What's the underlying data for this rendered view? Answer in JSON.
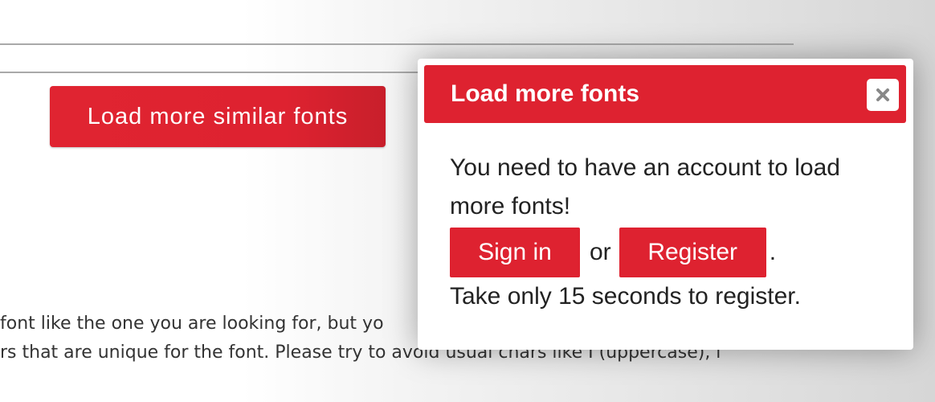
{
  "background": {
    "load_similar_label": "Load more similar fonts",
    "text_line_1": "font like the one you are looking for, but yo",
    "text_line_2": "rs that are unique for the font. Please try to avoid usual chars like I (uppercase), l"
  },
  "modal": {
    "title": "Load more fonts",
    "close_icon": "close-icon",
    "message_line_1": "You need to have an account to load",
    "message_line_2": "more fonts!",
    "signin_label": "Sign in",
    "or_text": "or",
    "register_label": "Register",
    "period": ".",
    "footer_text": "Take only 15 seconds to register."
  },
  "colors": {
    "accent": "#de2230",
    "text": "#222222"
  }
}
